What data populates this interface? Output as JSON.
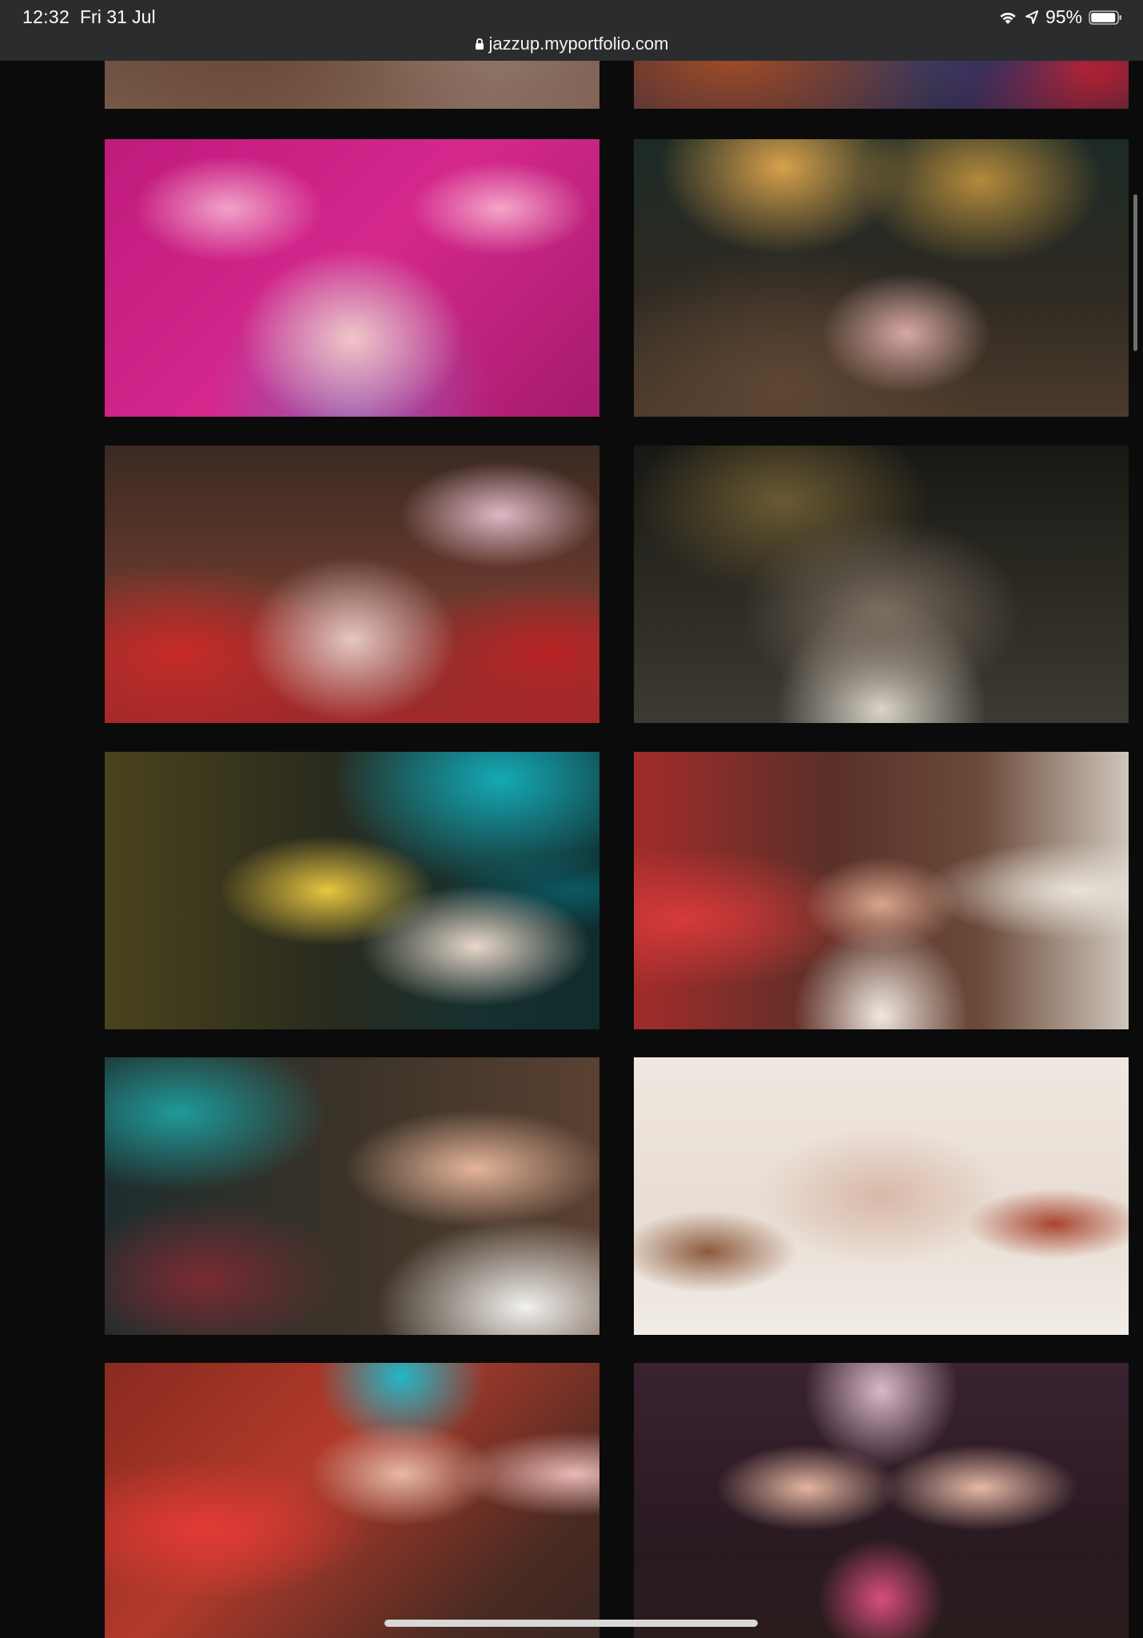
{
  "status_bar": {
    "time": "12:32",
    "date": "Fri 31 Jul",
    "battery_percent": "95%",
    "battery_level": 0.95,
    "icons": [
      "wifi-icon",
      "location-icon",
      "battery-icon"
    ]
  },
  "browser": {
    "url": "jazzup.myportfolio.com",
    "lock_icon": "lock-icon"
  },
  "gallery": {
    "photos": [
      {
        "id": "party-table-top-left"
      },
      {
        "id": "nightclub-party-top-right"
      },
      {
        "id": "hbd-pink-birthday-group"
      },
      {
        "id": "garden-night-birthday-group"
      },
      {
        "id": "red-booth-balloon-party"
      },
      {
        "id": "outdoor-dinner-group-waving"
      },
      {
        "id": "diner-neon-portrait"
      },
      {
        "id": "pouting-portrait-red-booth"
      },
      {
        "id": "pizza-bite-portrait"
      },
      {
        "id": "white-room-group-hearts"
      },
      {
        "id": "smiling-pointing-portrait"
      },
      {
        "id": "cupcake-friends-portrait"
      }
    ]
  },
  "colors": {
    "page_background": "#0b0b0b",
    "chrome_background": "#2b2c2e",
    "text": "#ffffff"
  }
}
